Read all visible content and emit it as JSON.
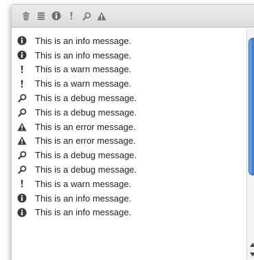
{
  "toolbar": {
    "buttons": [
      {
        "icon": "trash-icon"
      },
      {
        "icon": "list-icon"
      },
      {
        "icon": "info-icon"
      },
      {
        "icon": "warn-icon"
      },
      {
        "icon": "debug-icon"
      },
      {
        "icon": "error-icon"
      }
    ]
  },
  "log": {
    "rows": [
      {
        "level": "info",
        "icon": "info-icon",
        "text": "This is an info message."
      },
      {
        "level": "info",
        "icon": "info-icon",
        "text": "This is an info message."
      },
      {
        "level": "warn",
        "icon": "warn-icon",
        "text": "This is a warn message."
      },
      {
        "level": "warn",
        "icon": "warn-icon",
        "text": "This is a warn message."
      },
      {
        "level": "debug",
        "icon": "debug-icon",
        "text": "This is a debug message."
      },
      {
        "level": "debug",
        "icon": "debug-icon",
        "text": "This is a debug message."
      },
      {
        "level": "error",
        "icon": "error-icon",
        "text": "This is an error message."
      },
      {
        "level": "error",
        "icon": "error-icon",
        "text": "This is an error message."
      },
      {
        "level": "debug",
        "icon": "debug-icon",
        "text": "This is a debug message."
      },
      {
        "level": "debug",
        "icon": "debug-icon",
        "text": "This is a debug message."
      },
      {
        "level": "warn",
        "icon": "warn-icon",
        "text": "This is a warn message."
      },
      {
        "level": "info",
        "icon": "info-icon",
        "text": "This is an info message."
      },
      {
        "level": "info",
        "icon": "info-icon",
        "text": "This is an info message."
      }
    ]
  },
  "colors": {
    "icon_dark": "#3a3a3a",
    "toolbar_icon": "#777777",
    "scroll_thumb": "#3f82d1"
  }
}
